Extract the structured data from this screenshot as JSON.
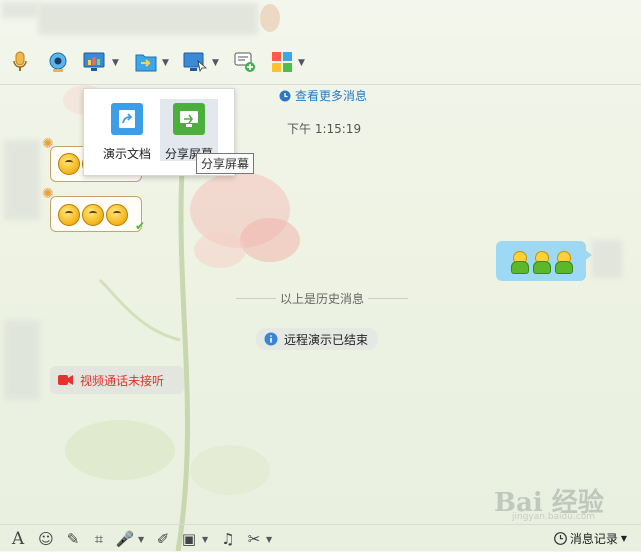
{
  "toolbar": {
    "icons": [
      "microphone-icon",
      "webcam-icon",
      "screen-present-icon",
      "file-transfer-icon",
      "remote-desktop-icon",
      "add-comment-icon",
      "apps-grid-icon"
    ]
  },
  "popup": {
    "items": [
      {
        "label": "演示文档"
      },
      {
        "label": "分享屏幕"
      }
    ],
    "tooltip": "分享屏幕"
  },
  "chat": {
    "view_more": "查看更多消息",
    "time": "下午 1:15:19",
    "history_divider": "以上是历史消息",
    "remote_end": "远程演示已结束",
    "video_missed": "视频通话未接听"
  },
  "bottom": {
    "record_label": "消息记录",
    "watermark": "Bai 经验",
    "watermark_sub": "jingyan.baidu.com"
  },
  "colors": {
    "accent_blue": "#2b78c2",
    "bubble_blue": "#9dd9f5",
    "missed_red": "#e8302c"
  }
}
